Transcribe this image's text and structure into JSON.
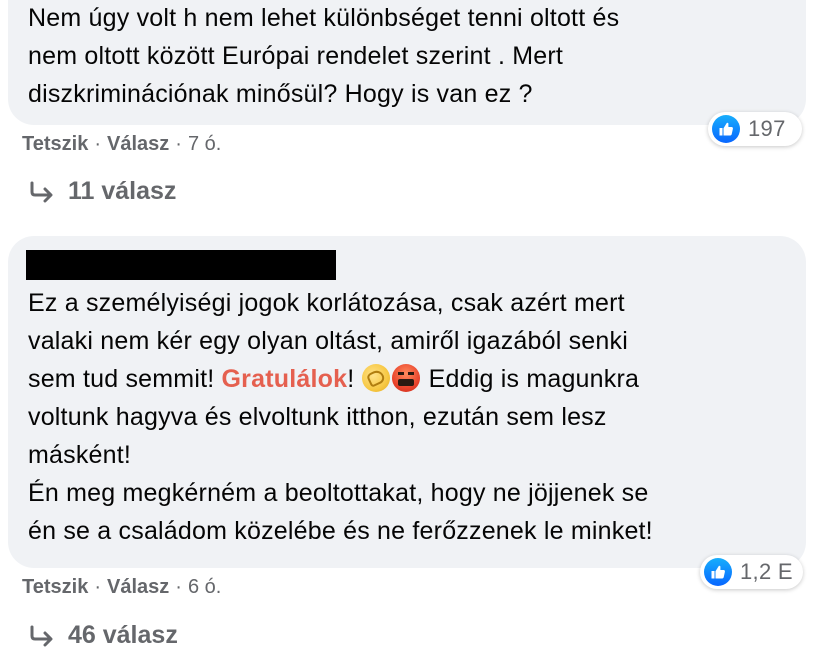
{
  "comments": [
    {
      "text_lines": [
        "Nem úgy volt h nem lehet különbséget tenni oltott és",
        "nem oltott között Európai rendelet szerint . Mert",
        "diszkriminációnak minősül? Hogy is van ez ?"
      ],
      "like_count": "197",
      "actions": {
        "like_label": "Tetszik",
        "reply_label": "Válasz",
        "separator": "·",
        "time": "7 ó."
      },
      "replies_label": "11 válasz"
    },
    {
      "text_lines": {
        "l1": "Ez a személyiségi jogok korlátozása, csak azért mert",
        "l2": "valaki nem kér egy olyan oltást, amiről igazából senki",
        "l3_pre": "sem tud semmit! ",
        "l3_highlight": "Gratulálok",
        "l3_mid": "! ",
        "l3_post": " Eddig is magunkra",
        "l4": "voltunk hagyva és elvoltunk itthon, ezután sem lesz",
        "l5": "másként!",
        "l6": "Én meg megkérném a beoltottakat, hogy ne jöjjenek se",
        "l7": "én se a családom közelébe és ne ferőzzenek le minket!"
      },
      "emojis": [
        "clapping-hands-emoji",
        "angry-face-emoji"
      ],
      "like_count": "1,2 E",
      "actions": {
        "like_label": "Tetszik",
        "reply_label": "Válasz",
        "separator": "·",
        "time": "6 ó."
      },
      "replies_label": "46 válasz"
    }
  ],
  "colors": {
    "bubble_bg": "#f0f2f5",
    "secondary_text": "#65676b",
    "like_blue": "#0866ff",
    "highlight": "#e5604f",
    "redaction": "#000000"
  },
  "icons": {
    "like": "thumbs-up-icon",
    "reply": "reply-arrow-icon"
  }
}
